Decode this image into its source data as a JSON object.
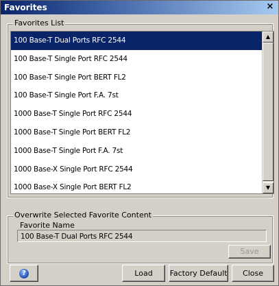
{
  "window": {
    "title": "Favorites",
    "close_glyph": "×"
  },
  "favorites_list": {
    "legend": "Favorites List",
    "items": [
      "100 Base-T Dual Ports RFC 2544",
      "100 Base-T Single Port RFC 2544",
      "100 Base-T Single Port BERT FL2",
      "100 Base-T Single Port F.A. 7st",
      "1000 Base-T Single Port RFC 2544",
      "1000 Base-T Single Port BERT FL2",
      "1000 Base-T Single Port F.A. 7st",
      "1000 Base-X Single Port RFC 2544",
      "1000 Base-X Single Port BERT FL2"
    ],
    "selected_index": 0
  },
  "overwrite": {
    "legend": "Overwrite Selected Favorite Content",
    "name_label": "Favorite Name",
    "name_value": "100 Base-T Dual Ports RFC 2544",
    "save_label": "Save"
  },
  "buttons": {
    "help_icon": "help-icon",
    "load": "Load",
    "factory_default": "Factory Default",
    "close": "Close"
  },
  "colors": {
    "selection": "#0a246a",
    "window_bg": "#d4d0c8"
  }
}
